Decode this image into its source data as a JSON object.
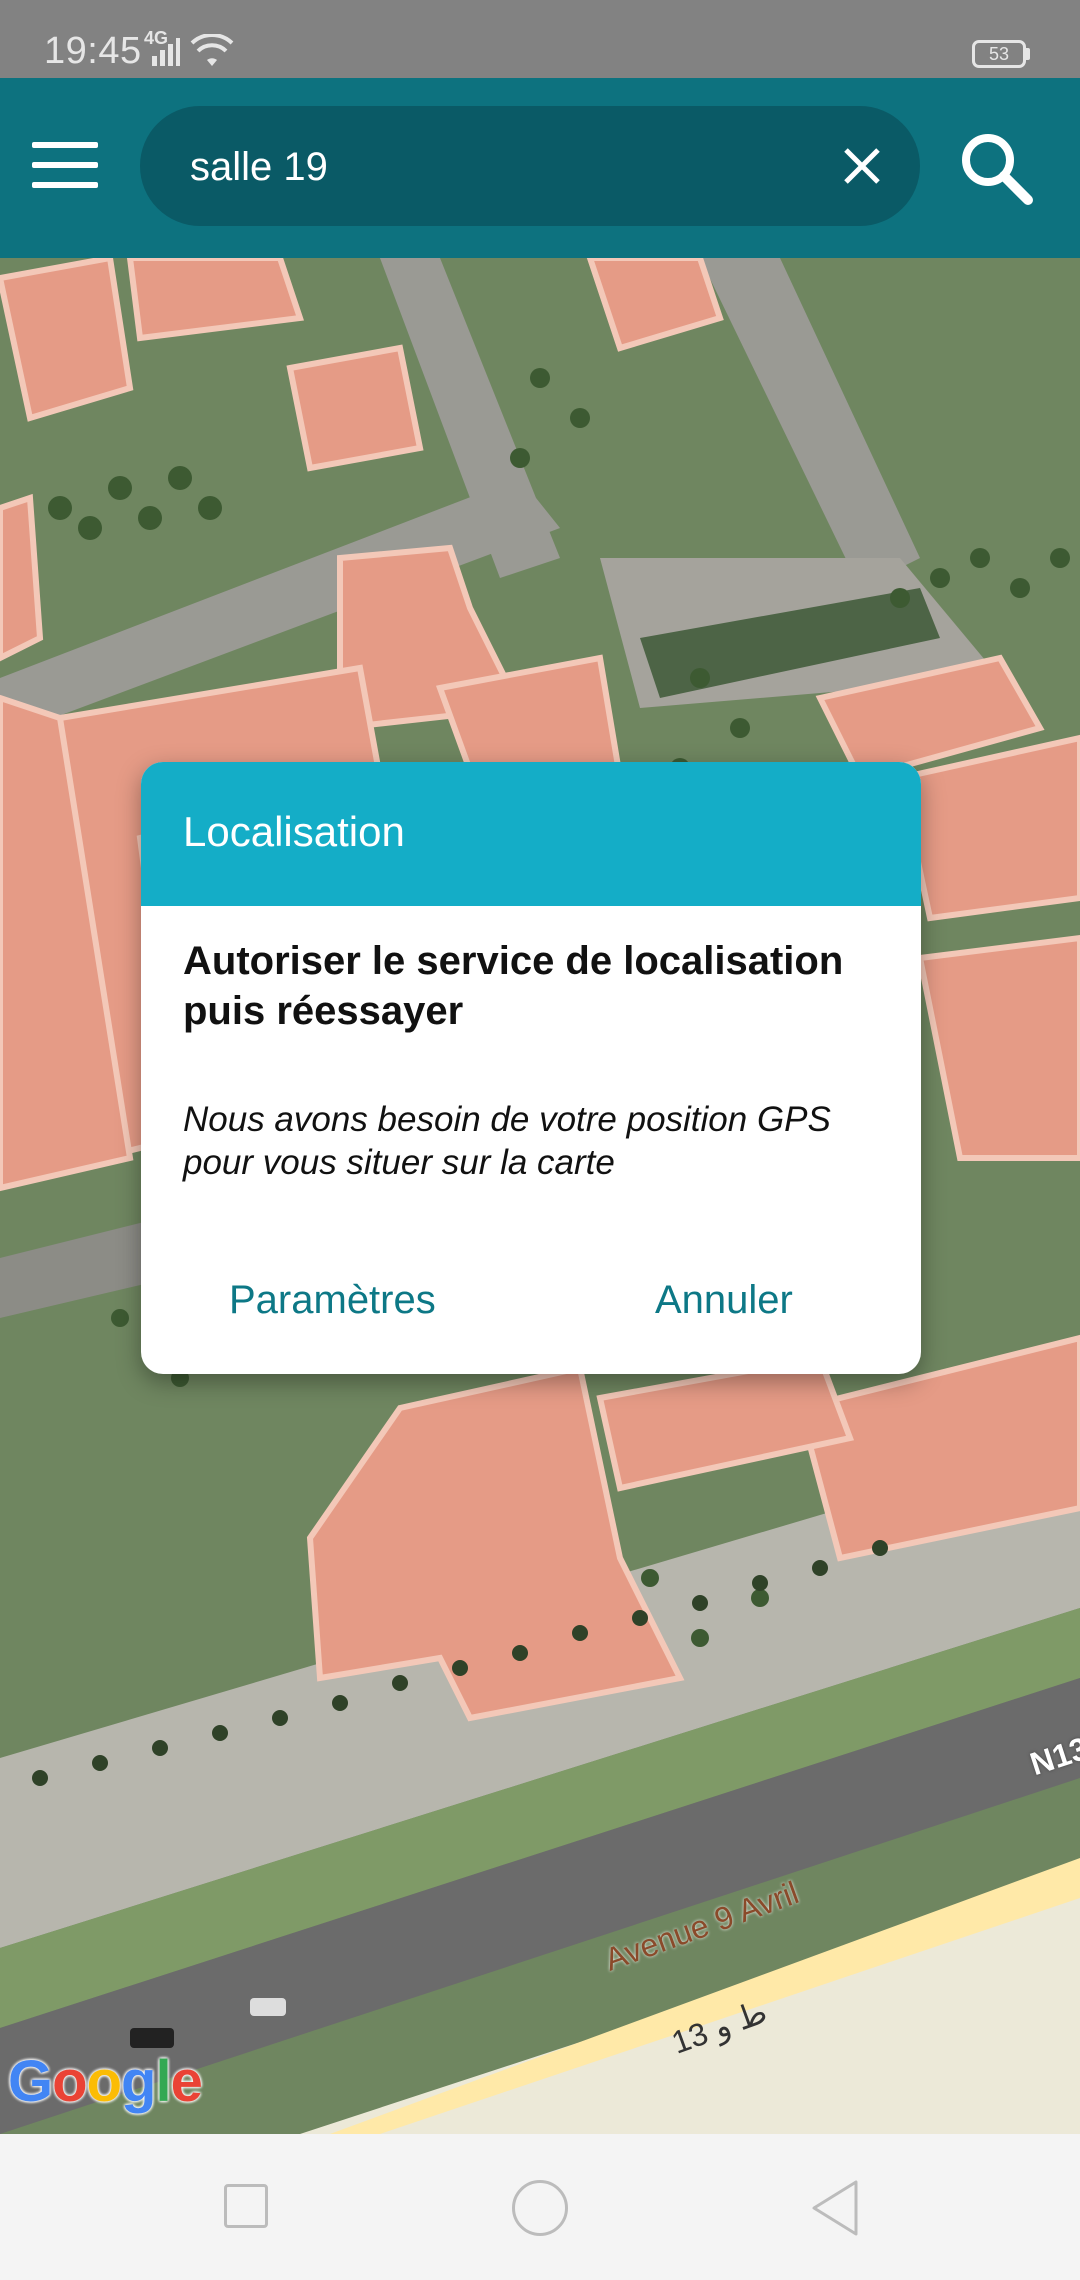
{
  "status_bar": {
    "time": "19:45",
    "network": "4G",
    "battery": "53"
  },
  "app_bar": {
    "search_value": "salle 19",
    "icons": [
      "menu-icon",
      "close-icon",
      "search-icon"
    ]
  },
  "map": {
    "road_label_fr": "Avenue 9 Avril",
    "road_label_ar": "ط و 13",
    "road_label_n": "N13",
    "google_letters": [
      {
        "char": "G",
        "color": "#4285F4"
      },
      {
        "char": "o",
        "color": "#EA4335"
      },
      {
        "char": "o",
        "color": "#FBBC05"
      },
      {
        "char": "g",
        "color": "#4285F4"
      },
      {
        "char": "l",
        "color": "#34A853"
      },
      {
        "char": "e",
        "color": "#EA4335"
      }
    ]
  },
  "dialog": {
    "title": "Localisation",
    "heading": "Autoriser le service de localisation puis réessayer",
    "message": "Nous avons besoin de votre position GPS pour vous situer sur la carte",
    "positive_button": "Paramètres",
    "negative_button": "Annuler",
    "accent_color": "#14adc7"
  },
  "nav_bar": {
    "icons": [
      "recent-apps-icon",
      "home-icon",
      "back-icon"
    ]
  }
}
